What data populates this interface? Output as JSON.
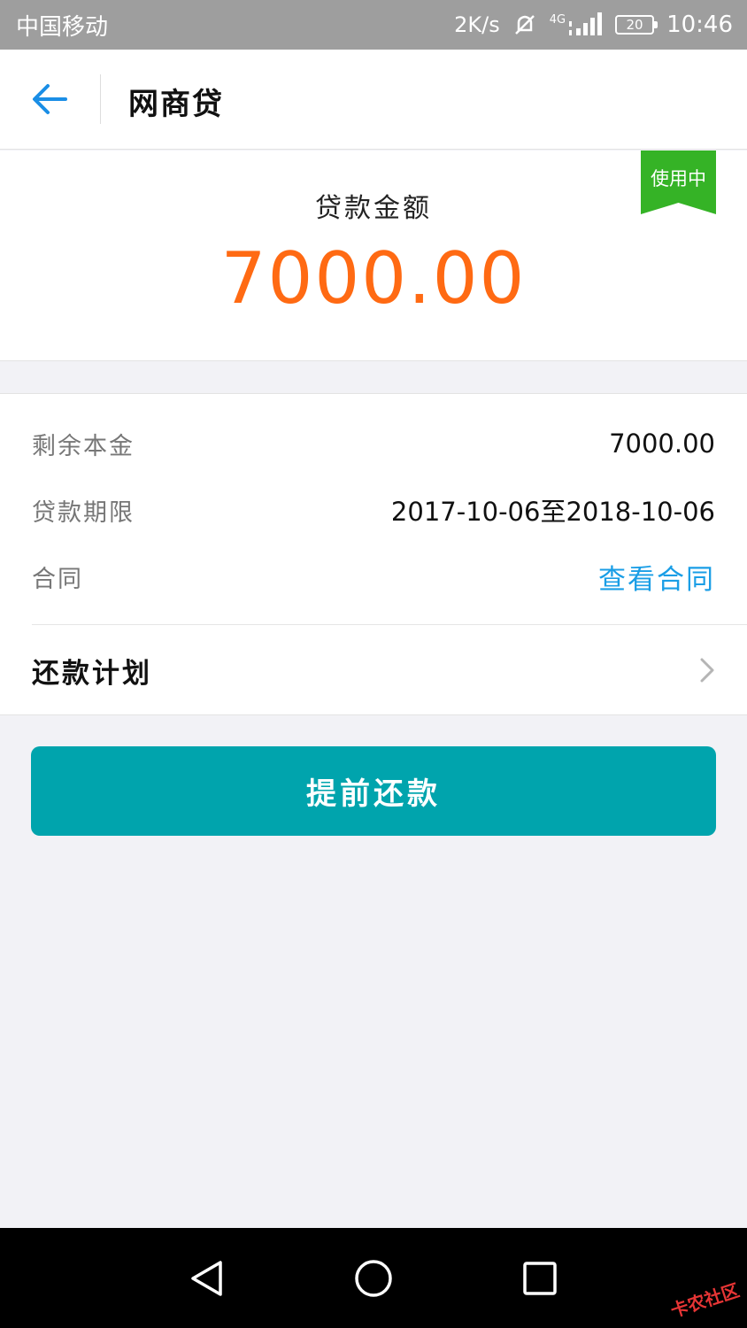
{
  "status_bar": {
    "carrier": "中国移动",
    "net_speed": "2K/s",
    "network_type": "4G",
    "battery": "20",
    "time": "10:46"
  },
  "header": {
    "title": "网商贷"
  },
  "loan": {
    "amount_label": "贷款金额",
    "amount": "7000.00",
    "status_badge": "使用中"
  },
  "details": {
    "rows": [
      {
        "label": "剩余本金",
        "value": "7000.00"
      },
      {
        "label": "贷款期限",
        "value": "2017-10-06至2018-10-06"
      },
      {
        "label": "合同",
        "value": "查看合同"
      }
    ],
    "plan_label": "还款计划"
  },
  "actions": {
    "prepay_label": "提前还款"
  },
  "watermark": "卡农社区",
  "colors": {
    "accent": "#00a4ad",
    "amount": "#ff6a13",
    "link": "#1a9ee6",
    "badge": "#35b326",
    "back_arrow": "#1a8ee6"
  }
}
